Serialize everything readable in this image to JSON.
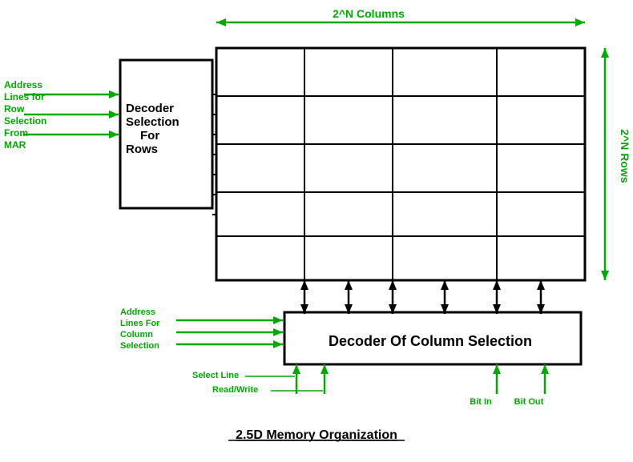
{
  "title": "2.5D Memory Organization",
  "labels": {
    "columns": "2^N Columns",
    "rows": "2^N Rows",
    "decoder_rows_title": "Decoder Selection For Rows",
    "decoder_col_title": "Decoder Of Column Selection",
    "address_lines_row": "Address Lines for Row Selection From MAR",
    "address_lines_col": "Address Lines For Column Selection",
    "select_line": "Select Line",
    "read_write": "Read/Write",
    "bit_in": "Bit In",
    "bit_out": "Bit Out",
    "main_title": "2.5D Memory Organization"
  },
  "colors": {
    "green": "#00AA00",
    "black": "#000000",
    "dark_green": "#008800"
  }
}
